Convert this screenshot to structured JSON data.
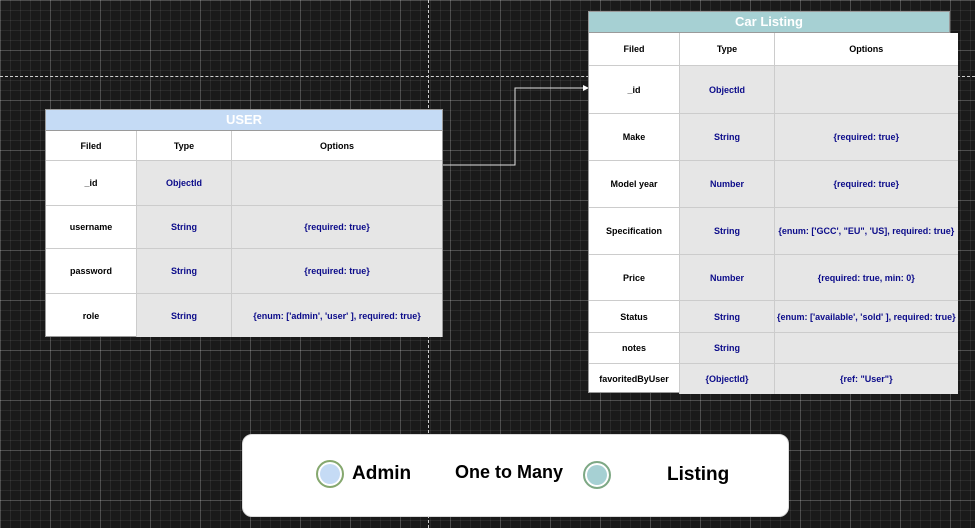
{
  "user_table": {
    "title": "USER",
    "headers": [
      "Filed",
      "Type",
      "Options"
    ],
    "rows": [
      [
        "_id",
        "ObjectId",
        ""
      ],
      [
        "username",
        "String",
        "{required: true}"
      ],
      [
        "password",
        "String",
        "{required: true}"
      ],
      [
        "role",
        "String",
        "{enum: ['admin',  'user' ], required: true}"
      ]
    ]
  },
  "car_table": {
    "title": "Car Listing",
    "headers": [
      "Filed",
      "Type",
      "Options"
    ],
    "rows": [
      [
        "_id",
        "ObjectId",
        ""
      ],
      [
        "Make",
        "String",
        "{required: true}"
      ],
      [
        "Model year",
        "Number",
        "{required: true}"
      ],
      [
        "Specification",
        "String",
        "{enum: ['GCC', \"EU\", 'US], required: true}"
      ],
      [
        "Price",
        "Number",
        "{required: true, min: 0}"
      ],
      [
        "Status",
        "String",
        "{enum: ['available', 'sold' ], required: true}"
      ],
      [
        "notes",
        "String",
        ""
      ],
      [
        "favoritedByUser",
        "{ObjectId}",
        "{ref: \"User\"}"
      ]
    ]
  },
  "legend": {
    "admin": "Admin",
    "relation": "One to Many",
    "listing": "Listing"
  },
  "colors": {
    "user_header": "#c5dbf5",
    "car_header": "#a6d0d3",
    "type_text": "#0b0b8a",
    "background": "#1a1a1a"
  }
}
